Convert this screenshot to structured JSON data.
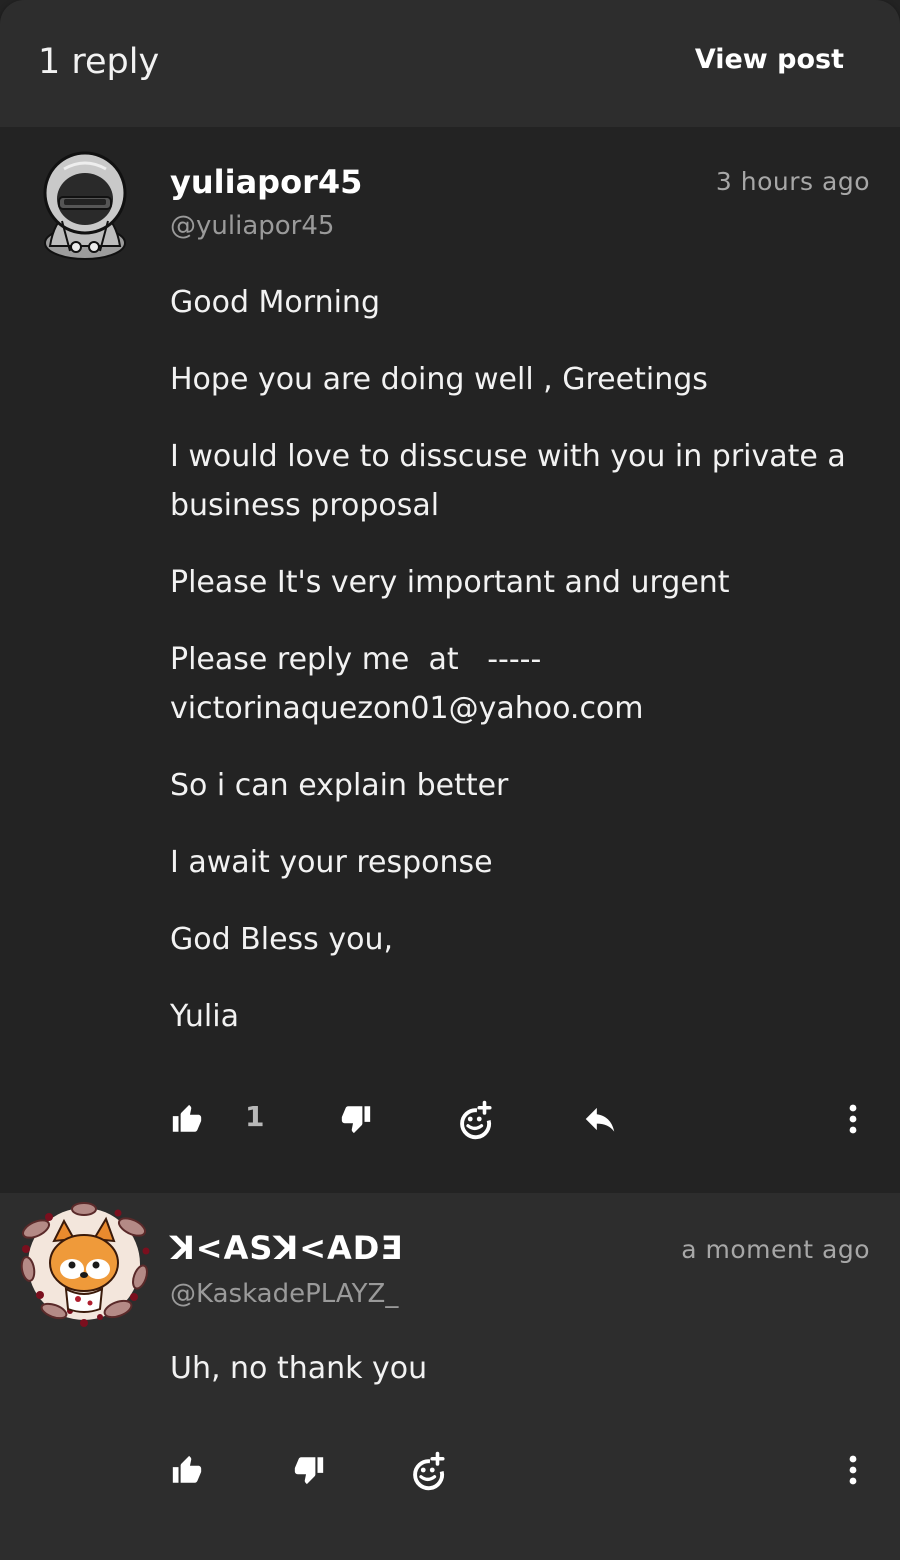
{
  "header": {
    "title": "1 reply",
    "view_post_label": "View post"
  },
  "comments": [
    {
      "username": "yuliapor45",
      "handle": "@yuliapor45",
      "timestamp": "3 hours ago",
      "avatar_icon": "hooded-figure-avatar",
      "paragraphs": [
        "Good Morning",
        "Hope you are doing well , Greetings",
        "I would love to disscuse with you in private a business proposal",
        "Please It's very important and urgent",
        "Please reply me  at   -----\nvictorinaquezon01@yahoo.com",
        "So i can explain better",
        "I await your response",
        "God Bless you,",
        "Yulia"
      ],
      "like_count": "1"
    },
    {
      "username": "ꓘ<ASꓘ<ADƎ",
      "handle": "@KaskadePLAYZ_",
      "timestamp": "a moment ago",
      "avatar_icon": "red-panda-avatar",
      "paragraphs": [
        "Uh, no thank you"
      ]
    }
  ],
  "icons": {
    "like": "thumbs-up-icon",
    "dislike": "thumbs-down-icon",
    "react": "add-reaction-icon",
    "reply": "reply-icon",
    "more": "more-vertical-icon"
  }
}
